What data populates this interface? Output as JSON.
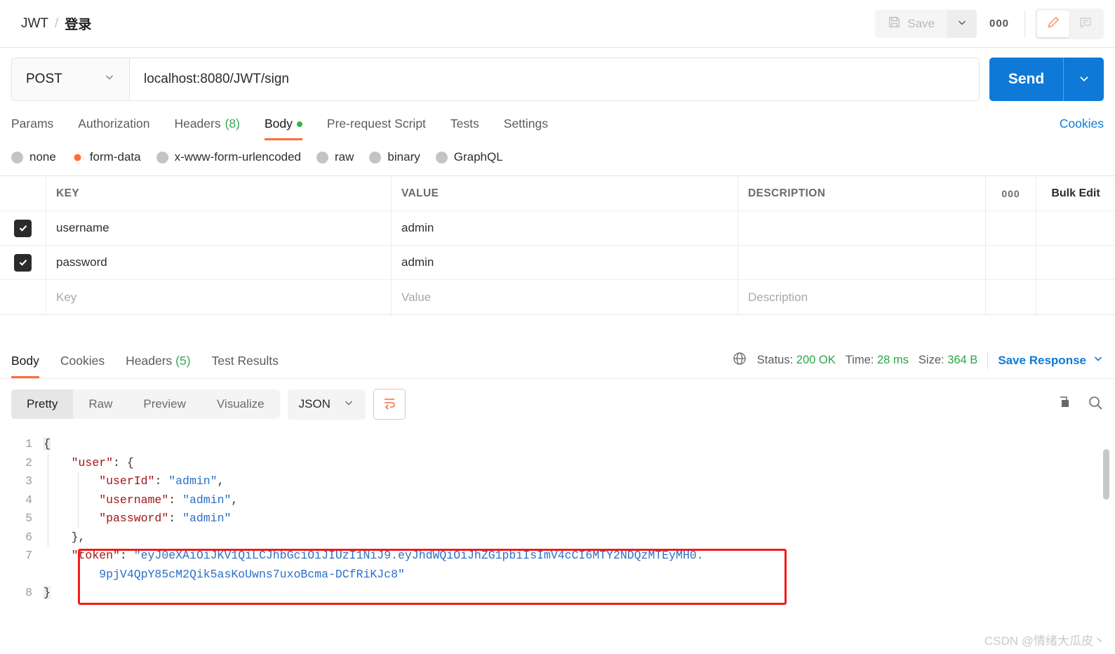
{
  "header": {
    "breadcrumb_root": "JWT",
    "breadcrumb_sep": "/",
    "breadcrumb_current": "登录",
    "save_label": "Save",
    "more_label": "000",
    "save_icon": "floppy-disk-icon",
    "caret_icon": "chevron-down-icon",
    "edit_icon": "pencil-icon",
    "comment_icon": "comment-icon"
  },
  "request": {
    "method": "POST",
    "url": "localhost:8080/JWT/sign",
    "send_label": "Send",
    "tabs": [
      {
        "label": "Params",
        "active": false
      },
      {
        "label": "Authorization",
        "active": false
      },
      {
        "label": "Headers",
        "count": "(8)",
        "active": false
      },
      {
        "label": "Body",
        "dot": true,
        "active": true
      },
      {
        "label": "Pre-request Script",
        "active": false
      },
      {
        "label": "Tests",
        "active": false
      },
      {
        "label": "Settings",
        "active": false
      }
    ],
    "cookies_link": "Cookies",
    "body_types": [
      {
        "label": "none",
        "selected": false
      },
      {
        "label": "form-data",
        "selected": true
      },
      {
        "label": "x-www-form-urlencoded",
        "selected": false
      },
      {
        "label": "raw",
        "selected": false
      },
      {
        "label": "binary",
        "selected": false
      },
      {
        "label": "GraphQL",
        "selected": false
      }
    ],
    "table": {
      "headers": {
        "key": "KEY",
        "value": "VALUE",
        "description": "DESCRIPTION",
        "dots": "000",
        "bulk_edit": "Bulk Edit"
      },
      "rows": [
        {
          "checked": true,
          "key": "username",
          "value": "admin",
          "description": ""
        },
        {
          "checked": true,
          "key": "password",
          "value": "admin",
          "description": ""
        }
      ],
      "placeholder_row": {
        "key": "Key",
        "value": "Value",
        "description": "Description"
      }
    }
  },
  "response": {
    "tabs": [
      {
        "label": "Body",
        "active": true
      },
      {
        "label": "Cookies",
        "active": false
      },
      {
        "label": "Headers",
        "count": "(5)",
        "active": false
      },
      {
        "label": "Test Results",
        "active": false
      }
    ],
    "globe_icon": "globe-icon",
    "status_label": "Status:",
    "status_value": "200 OK",
    "time_label": "Time:",
    "time_value": "28 ms",
    "size_label": "Size:",
    "size_value": "364 B",
    "save_response_label": "Save Response",
    "viewer": {
      "modes": [
        {
          "label": "Pretty",
          "active": true
        },
        {
          "label": "Raw",
          "active": false
        },
        {
          "label": "Preview",
          "active": false
        },
        {
          "label": "Visualize",
          "active": false
        }
      ],
      "format": "JSON",
      "wrap_icon": "word-wrap-icon",
      "copy_icon": "copy-icon",
      "search_icon": "search-icon"
    },
    "code_lines": [
      "1",
      "2",
      "3",
      "4",
      "5",
      "6",
      "7",
      "8"
    ],
    "body": {
      "l1": "{",
      "l2_key": "\"user\"",
      "l2_rest": ": {",
      "l3_key": "\"userId\"",
      "l3_val": "\"admin\"",
      "l4_key": "\"username\"",
      "l4_val": "\"admin\"",
      "l5_key": "\"password\"",
      "l5_val": "\"admin\"",
      "l6": "},",
      "l7_key": "\"token\"",
      "l7_val_part1": "\"eyJ0eXAiOiJKV1QiLCJhbGciOiJIUzI1NiJ9.eyJhdWQiOiJhZG1pbiIsImV4cCI6MTY2NDQzMTEyMH0.",
      "l7_val_part2": "9pjV4QpY85cM2Qik5asKoUwns7uxoBcma-DCfRiKJc8\"",
      "l8": "}"
    }
  },
  "watermark": "CSDN @情绪大瓜皮丶",
  "colors": {
    "accent": "#ff6c37",
    "link": "#0f79d7",
    "success": "#2aa745",
    "highlight_border": "#f31b1b"
  }
}
